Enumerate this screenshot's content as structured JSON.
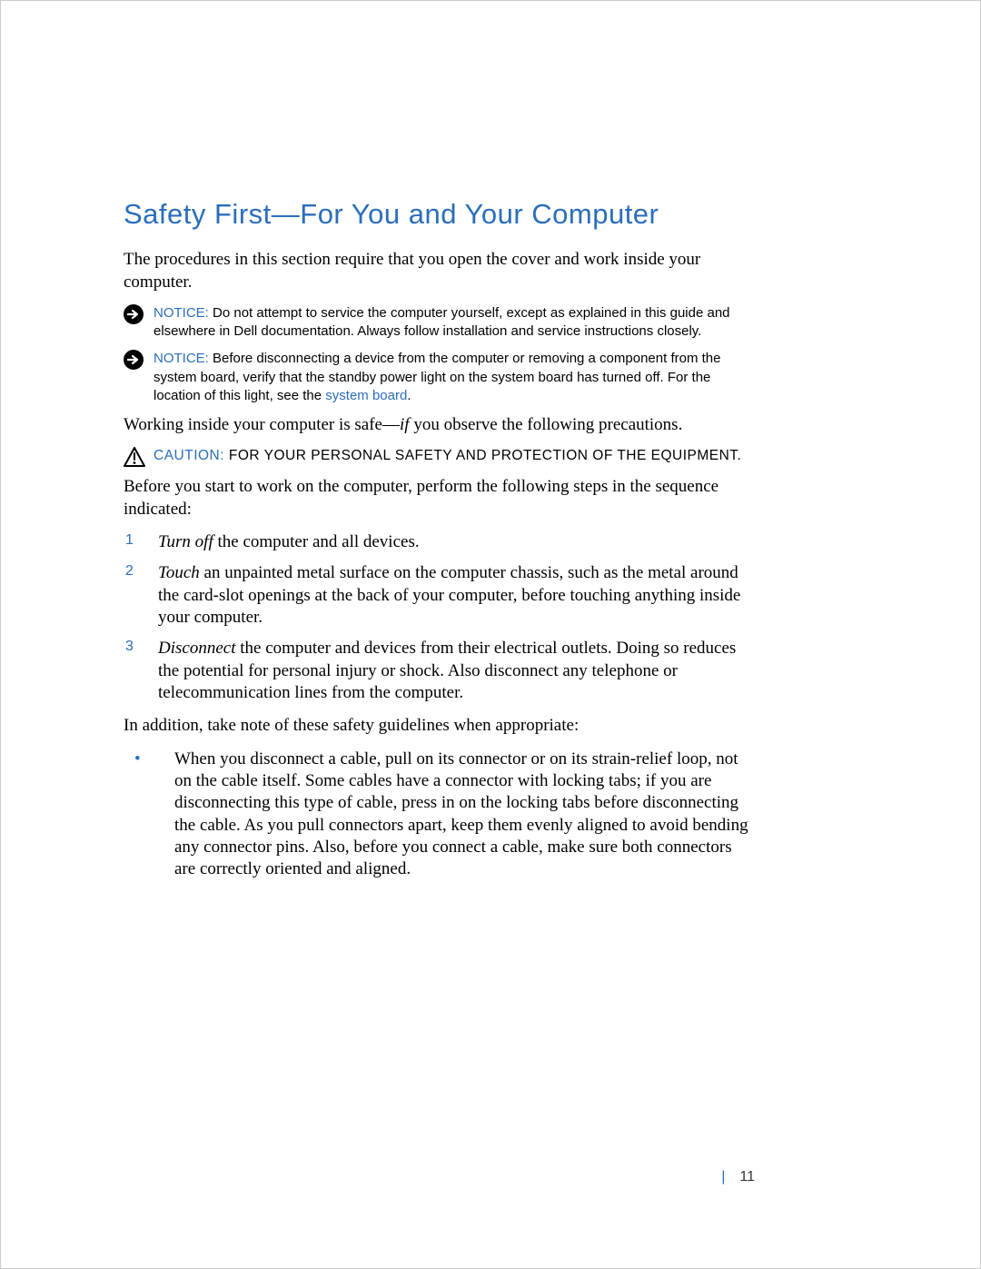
{
  "heading": "Safety First—For You and Your Computer",
  "intro": "The procedures in this section require that you open the cover and work inside your computer.",
  "notices": {
    "label": "NOTICE:",
    "n1": " Do not attempt to service the computer yourself, except as explained in this guide and elsewhere in Dell documentation. Always follow installation and service instructions closely.",
    "n2a": " Before disconnecting a device from the computer or removing a component from the system board, verify that the standby power light on the system board has turned off. For the location of this light, see the ",
    "n2link": "system board",
    "n2b": "."
  },
  "working": {
    "pre": "Working inside your computer is safe—",
    "if": "if",
    "post": " you observe the following precautions."
  },
  "caution": {
    "label": "CAUTION: ",
    "text": "FOR YOUR PERSONAL SAFETY AND PROTECTION OF THE EQUIPMENT."
  },
  "before": "Before you start to work on the computer, perform the following steps in the sequence indicated:",
  "steps": {
    "s1": {
      "num": "1",
      "verb": "Turn off",
      "rest": " the computer and all devices."
    },
    "s2": {
      "num": "2",
      "verb": "Touch",
      "rest": " an unpainted metal surface on the computer chassis, such as the metal around the card-slot openings at the back of your computer, before touching anything inside your computer."
    },
    "s3": {
      "num": "3",
      "verb": "Disconnect",
      "rest": " the computer and devices from their electrical outlets. Doing so reduces the potential for personal injury or shock. Also disconnect any telephone or telecommunication lines from the computer."
    }
  },
  "addition": "In addition, take note of these safety guidelines when appropriate:",
  "bullets": {
    "b1": "When you disconnect a cable, pull on its connector or on its strain-relief loop, not on the cable itself. Some cables have a connector with locking tabs; if you are disconnecting this type of cable, press in on the locking tabs before disconnecting the cable. As you pull connectors apart, keep them evenly aligned to avoid bending any connector pins. Also, before you connect a cable, make sure both connectors are correctly oriented and aligned."
  },
  "page": {
    "bar": "|",
    "num": "11"
  }
}
